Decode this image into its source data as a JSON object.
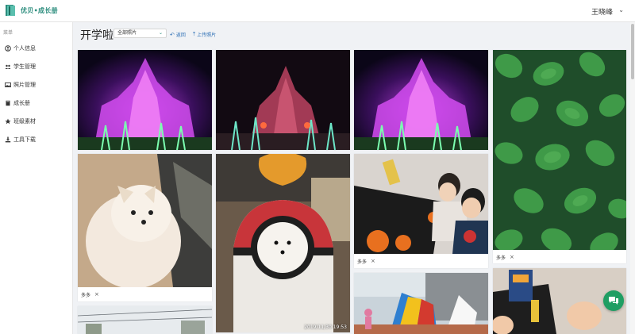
{
  "header": {
    "brand": "优贝•成长册",
    "user_name": "王晓峰",
    "user_caret": "⌄"
  },
  "sidebar": {
    "menu_title": "菜单",
    "items": [
      {
        "label": "个人信息",
        "icon": "user-circle-icon"
      },
      {
        "label": "学生管理",
        "icon": "users-icon"
      },
      {
        "label": "照片管理",
        "icon": "image-icon"
      },
      {
        "label": "成长册",
        "icon": "book-icon"
      },
      {
        "label": "班级素材",
        "icon": "star-icon"
      },
      {
        "label": "工具下载",
        "icon": "download-icon"
      }
    ]
  },
  "toolbar": {
    "title": "开学啦",
    "album_select_value": "全部照片",
    "back_label": "返回",
    "upload_label": "上传照片"
  },
  "photos": {
    "tag_dodo": "多多",
    "remove_icon": "×",
    "timestamp": "2019/11/30  19:53"
  },
  "colors": {
    "accent": "#2a8c7c",
    "link": "#2d6fb5",
    "chat": "#1f9e63"
  }
}
